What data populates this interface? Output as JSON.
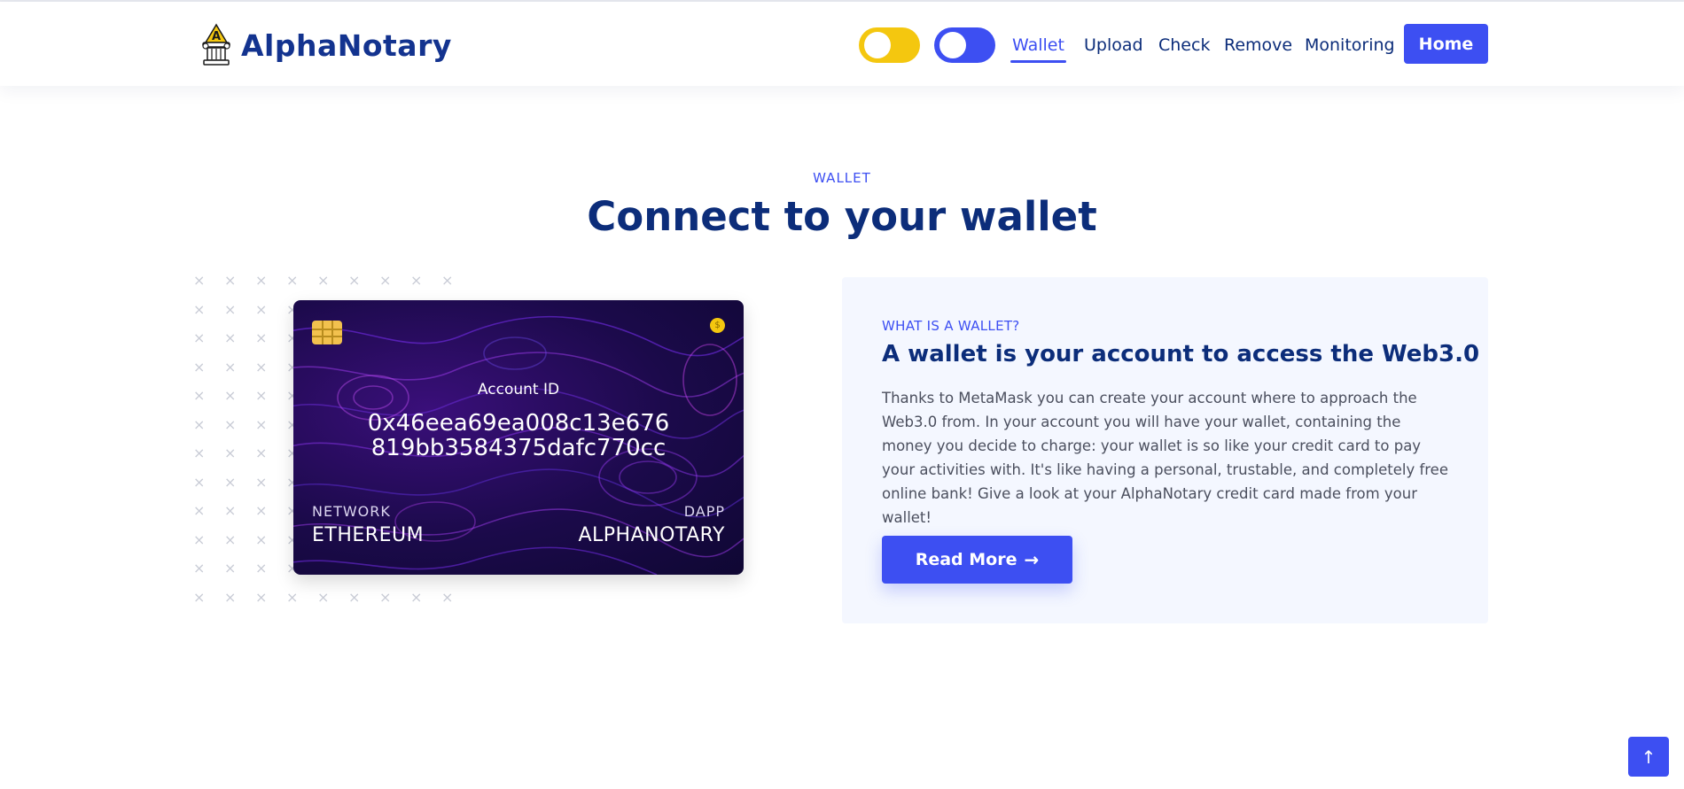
{
  "header": {
    "brand": "AlphaNotary",
    "brand_icon": "notary-column-icon",
    "toggles": [
      {
        "name": "theme-toggle",
        "color": "#f4c70f",
        "state": "off"
      },
      {
        "name": "mode-toggle",
        "color": "#3d4ff2",
        "state": "off"
      }
    ],
    "nav": [
      "Wallet",
      "Upload",
      "Check",
      "Remove",
      "Monitoring"
    ],
    "active_nav": "Wallet",
    "home_label": "Home"
  },
  "section": {
    "tag": "WALLET",
    "title": "Connect to your wallet"
  },
  "card": {
    "account_label": "Account ID",
    "account_id_line1": "0x46eea69ea008c13e676",
    "account_id_line2": "819bb3584375dafc770cc",
    "network_label": "NETWORK",
    "network_value": "ETHEREUM",
    "dapp_label": "DAPP",
    "dapp_value": "ALPHANOTARY",
    "chip_icon": "sim-chip-icon",
    "coin_icon": "coin-icon"
  },
  "info": {
    "tag": "WHAT IS A WALLET?",
    "title": "A wallet is your account to access the Web3.0",
    "body": "Thanks to MetaMask you can create your account where to approach the Web3.0 from. In your account you will have your wallet, containing the money you decide to charge: your wallet is so like your credit card to pay your activities with. It's like having a personal, trustable, and completely free online bank! Give a look at your AlphaNotary credit card made from your wallet!",
    "button_label": "Read More",
    "button_icon": "arrow-right-icon"
  },
  "back_to_top": {
    "icon": "arrow-up-icon"
  },
  "colors": {
    "accent": "#3d4ff2",
    "navy": "#0c2d7a",
    "yellow": "#f4c70f",
    "panel": "#f4f7ff"
  }
}
